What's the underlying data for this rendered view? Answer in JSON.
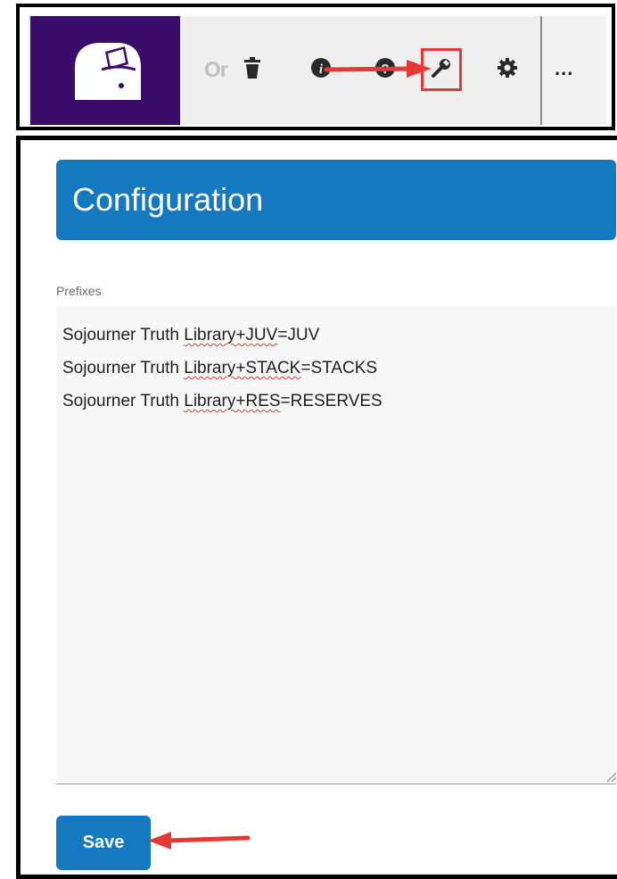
{
  "toolbar": {
    "truncated_text": "Or",
    "icons": [
      "app-logo",
      "trash-icon",
      "info-icon",
      "help-icon",
      "wrench-icon",
      "gear-icon",
      "more-icon"
    ],
    "more_label": "...",
    "highlight_color": "#e53935"
  },
  "config": {
    "title": "Configuration",
    "prefixes_label": "Prefixes",
    "prefix_lines": [
      {
        "a": "Sojourner Truth ",
        "b": "Library+JUV",
        "c": "=JUV"
      },
      {
        "a": "Sojourner Truth ",
        "b": "Library+STACK",
        "c": "=STACKS"
      },
      {
        "a": "Sojourner Truth ",
        "b": "Library+RES",
        "c": "=RESERVES"
      }
    ],
    "save_label": "Save",
    "accent_color": "#1579bf"
  }
}
